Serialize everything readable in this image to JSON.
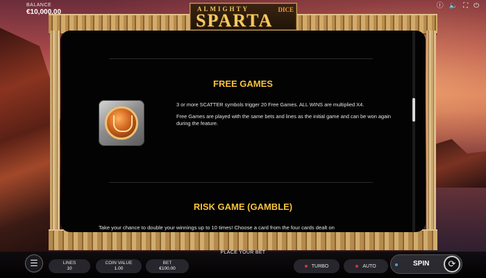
{
  "header": {
    "balance_label": "BALANCE",
    "balance_value": "€10,000.00",
    "icons": [
      "info-icon",
      "sound-icon",
      "fullscreen-icon",
      "power-icon"
    ]
  },
  "logo": {
    "line1": "ALMIGHTY",
    "line2": "SPARTA",
    "badge": "DICE"
  },
  "panel": {
    "free_games": {
      "title": "FREE GAMES",
      "para1": "3 or more SCATTER symbols trigger 20 Free Games. ALL WINS are multiplied X4.",
      "para2": "Free Games are played with the same bets and lines as the initial game and can be won again during the feature."
    },
    "risk_game": {
      "title": "RISK GAME (GAMBLE)",
      "para1": "Take your chance to double your winnings up to 10 times! Choose a card from the four cards dealt on"
    },
    "scroll_position": 0.38
  },
  "controls": {
    "prompt": "PLACE YOUR BET",
    "lines_label": "LINES",
    "lines_value": "10",
    "coin_label": "COIN VALUE",
    "coin_value": "1.00",
    "bet_label": "BET",
    "bet_value": "€100.00",
    "turbo_label": "TURBO",
    "auto_label": "AUTO",
    "spin_label": "SPIN"
  },
  "colors": {
    "title": "#f7c23c",
    "indicator": "#e0313b",
    "spin_indicator": "#3ea0ff"
  }
}
